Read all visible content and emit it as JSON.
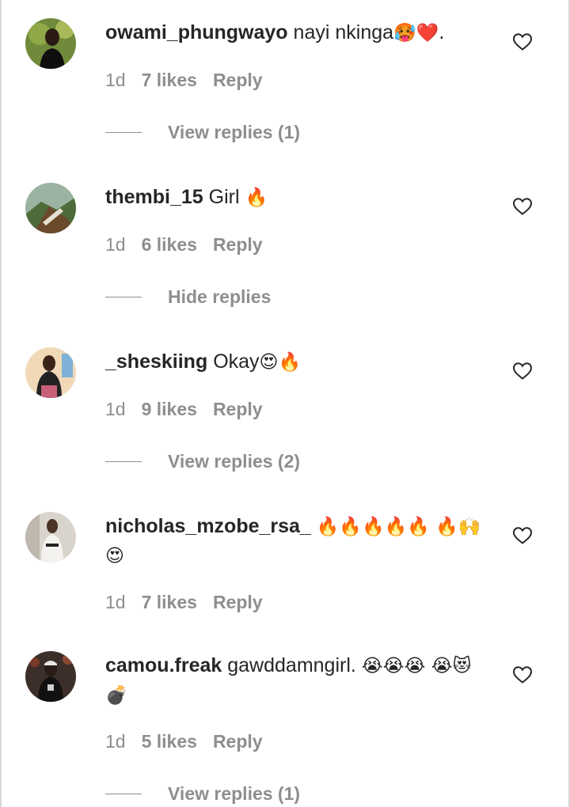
{
  "comments": [
    {
      "username": "owami_phungwayo",
      "text": "nayi nkinga",
      "emoji": "🥵❤️.",
      "time": "1d",
      "likes": "7 likes",
      "reply": "Reply",
      "replies_label": "View replies (1)",
      "heart_icon": "heart-outline-icon"
    },
    {
      "username": "thembi_15",
      "text": "Girl",
      "emoji": "🔥",
      "time": "1d",
      "likes": "6 likes",
      "reply": "Reply",
      "replies_label": "Hide replies",
      "heart_icon": "heart-outline-icon"
    },
    {
      "username": "_sheskiing",
      "text": "Okay",
      "emoji": "😍🔥",
      "time": "1d",
      "likes": "9 likes",
      "reply": "Reply",
      "replies_label": "View replies (2)",
      "heart_icon": "heart-outline-icon"
    },
    {
      "username": "nicholas_mzobe_rsa_",
      "text": "",
      "emoji": "🔥🔥🔥🔥🔥 🔥🙌😍",
      "time": "1d",
      "likes": "7 likes",
      "reply": "Reply",
      "replies_label": "",
      "heart_icon": "heart-outline-icon"
    },
    {
      "username": "camou.freak",
      "text": "gawddamngirl.",
      "emoji": "😭😭😭 😭😻💣",
      "time": "1d",
      "likes": "5 likes",
      "reply": "Reply",
      "replies_label": "View replies (1)",
      "heart_icon": "heart-outline-icon"
    }
  ],
  "colors": {
    "text": "#262626",
    "secondary": "#8e8e8e",
    "background": "#ffffff"
  }
}
